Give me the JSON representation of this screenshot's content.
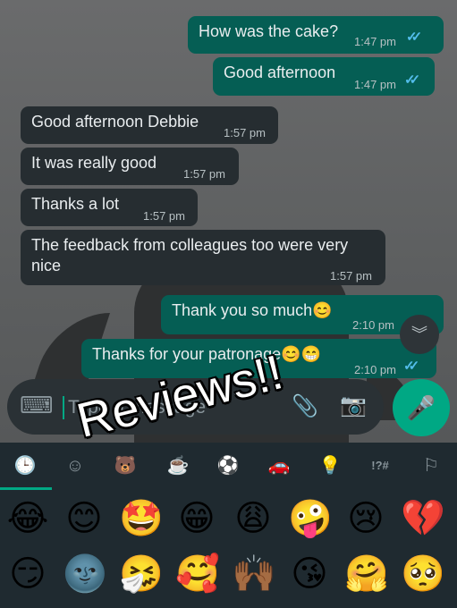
{
  "messages": [
    {
      "dir": "out",
      "text": "How was the cake?",
      "time": "1:47 pm",
      "ticks": "✓✓"
    },
    {
      "dir": "out",
      "text": "Good afternoon",
      "time": "1:47 pm",
      "ticks": "✓✓"
    },
    {
      "dir": "in",
      "text": "Good afternoon Debbie",
      "time": "1:57 pm"
    },
    {
      "dir": "in",
      "text": "It was really good",
      "time": "1:57 pm"
    },
    {
      "dir": "in",
      "text": "Thanks a lot",
      "time": "1:57 pm"
    },
    {
      "dir": "in",
      "text": "The feedback from colleagues too were very nice",
      "time": "1:57 pm"
    },
    {
      "dir": "out",
      "text": "Thank you so much",
      "emoji": "😊",
      "time": "2:10 pm"
    },
    {
      "dir": "out",
      "text": "Thanks for your patronage",
      "emoji": "😊😁",
      "time": "2:10 pm",
      "ticks": "✓✓"
    }
  ],
  "scroll_down_icon": "︾",
  "composer": {
    "placeholder": "Type a message",
    "keyboard_icon": "⌨",
    "attach_icon": "📎",
    "camera_icon": "📷",
    "mic_icon": "🎤"
  },
  "emoji_tabs": [
    "🕒",
    "☺",
    "🐻",
    "☕",
    "⚽",
    "🚗",
    "💡",
    "!?#",
    "⚐"
  ],
  "emoji_rows": [
    [
      "😂",
      "😊",
      "🤩",
      "😁",
      "😩",
      "🤪",
      "😢",
      "💔"
    ],
    [
      "😏",
      "🌚",
      "🤧",
      "🥰",
      "🙌🏾",
      "😘",
      "🤗",
      "🥺"
    ]
  ],
  "overlay_text": "Reviews!!",
  "colors": {
    "incoming": "#262d31",
    "outgoing": "#055e54",
    "accent": "#00a884",
    "read_ticks": "#53bdeb"
  }
}
